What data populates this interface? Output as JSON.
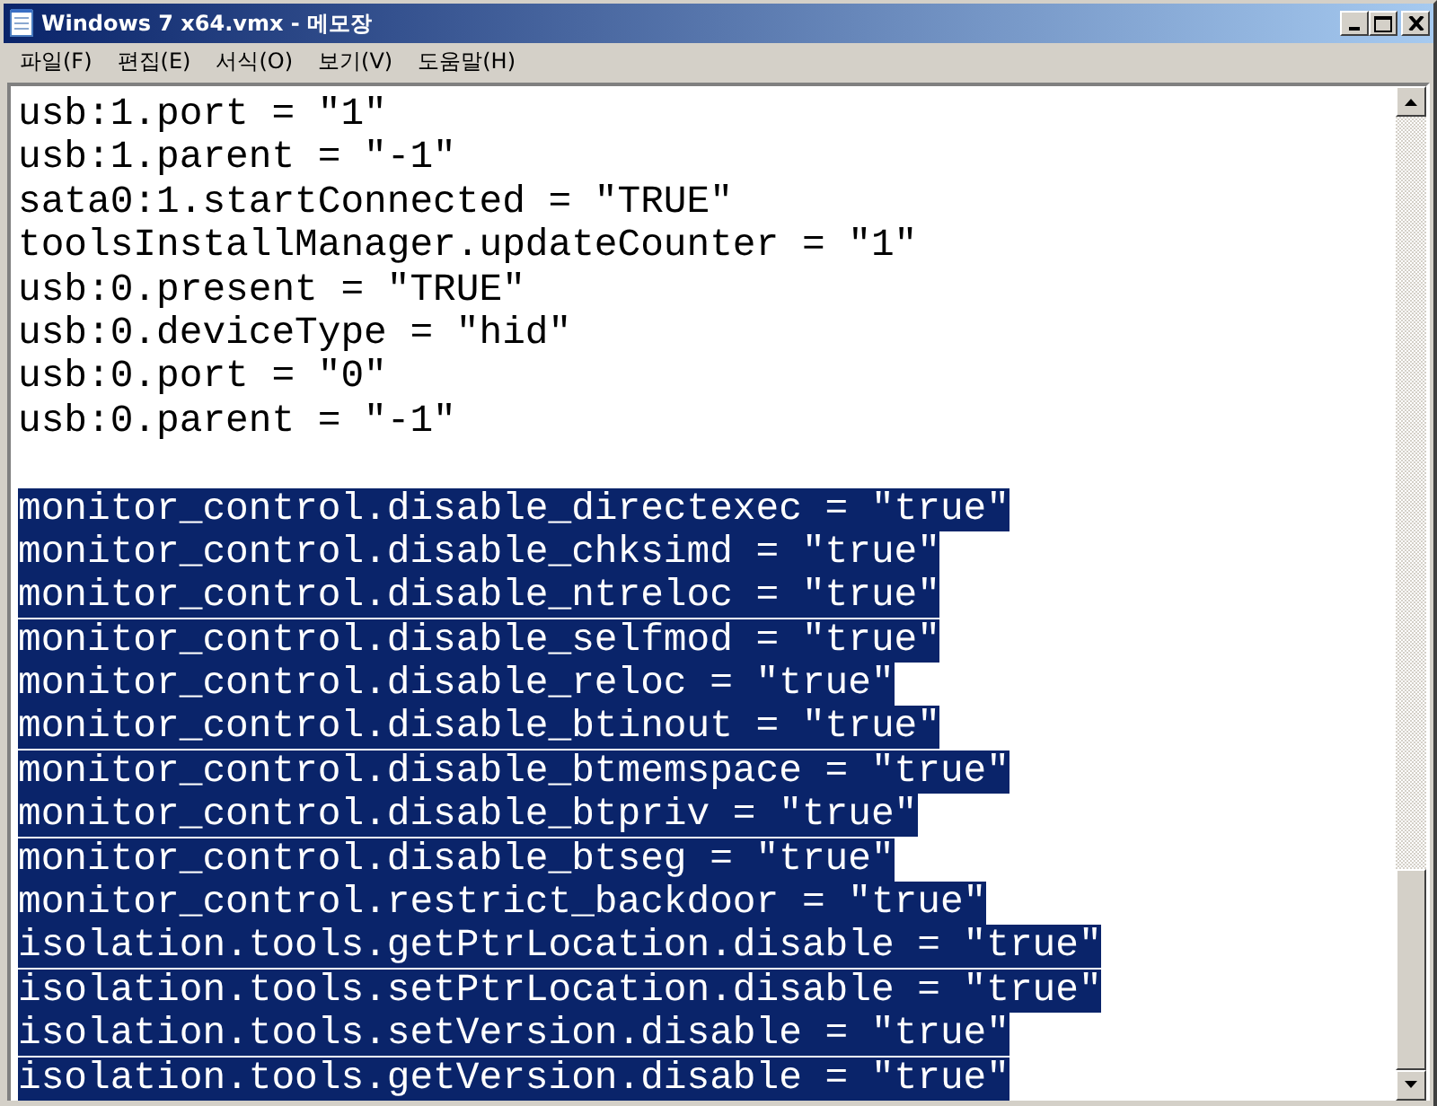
{
  "window": {
    "title": "Windows 7 x64.vmx - 메모장"
  },
  "menu": [
    "파일(F)",
    "편집(E)",
    "서식(O)",
    "보기(V)",
    "도움말(H)"
  ],
  "lines": [
    {
      "text": "usb:1.port = \"1\"",
      "selected": false
    },
    {
      "text": "usb:1.parent = \"-1\"",
      "selected": false
    },
    {
      "text": "sata0:1.startConnected = \"TRUE\"",
      "selected": false
    },
    {
      "text": "toolsInstallManager.updateCounter = \"1\"",
      "selected": false
    },
    {
      "text": "usb:0.present = \"TRUE\"",
      "selected": false
    },
    {
      "text": "usb:0.deviceType = \"hid\"",
      "selected": false
    },
    {
      "text": "usb:0.port = \"0\"",
      "selected": false
    },
    {
      "text": "usb:0.parent = \"-1\"",
      "selected": false
    },
    {
      "selected": false
    },
    {
      "text": "monitor_control.disable_directexec = \"true\"",
      "selected": true
    },
    {
      "text": "monitor_control.disable_chksimd = \"true\"",
      "selected": true
    },
    {
      "text": "monitor_control.disable_ntreloc = \"true\"",
      "selected": true
    },
    {
      "text": "monitor_control.disable_selfmod = \"true\"",
      "selected": true
    },
    {
      "text": "monitor_control.disable_reloc = \"true\"",
      "selected": true
    },
    {
      "text": "monitor_control.disable_btinout = \"true\"",
      "selected": true
    },
    {
      "text": "monitor_control.disable_btmemspace = \"true\"",
      "selected": true
    },
    {
      "text": "monitor_control.disable_btpriv = \"true\"",
      "selected": true
    },
    {
      "text": "monitor_control.disable_btseg = \"true\"",
      "selected": true
    },
    {
      "text": "monitor_control.restrict_backdoor = \"true\"",
      "selected": true
    },
    {
      "text": "isolation.tools.getPtrLocation.disable = \"true\"",
      "selected": true
    },
    {
      "text": "isolation.tools.setPtrLocation.disable = \"true\"",
      "selected": true
    },
    {
      "text": "isolation.tools.setVersion.disable = \"true\"",
      "selected": true
    },
    {
      "text": "isolation.tools.getVersion.disable = \"true\"",
      "selected": true
    }
  ]
}
